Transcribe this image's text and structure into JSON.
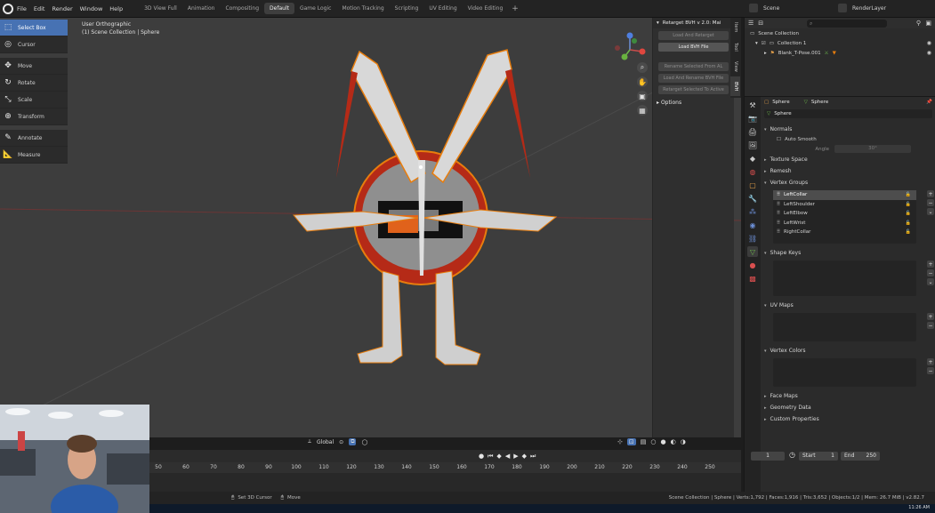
{
  "menu": [
    "File",
    "Edit",
    "Render",
    "Window",
    "Help"
  ],
  "workspaces": [
    "3D View Full",
    "Animation",
    "Compositing",
    "Default",
    "Game Logic",
    "Motion Tracking",
    "Scripting",
    "UV Editing",
    "Video Editing"
  ],
  "active_workspace": "Default",
  "scene": "Scene",
  "view_layer": "RenderLayer",
  "viewport": {
    "view_name": "User Orthographic",
    "collection_path": "(1) Scene Collection | Sphere"
  },
  "tools": [
    {
      "label": "Select Box",
      "icon": "select-box-icon"
    },
    {
      "label": "Cursor",
      "icon": "cursor-icon"
    },
    {
      "label": "Move",
      "icon": "move-icon"
    },
    {
      "label": "Rotate",
      "icon": "rotate-icon"
    },
    {
      "label": "Scale",
      "icon": "scale-icon"
    },
    {
      "label": "Transform",
      "icon": "transform-icon"
    },
    {
      "label": "Annotate",
      "icon": "annotate-icon"
    },
    {
      "label": "Measure",
      "icon": "measure-icon"
    }
  ],
  "npanel": {
    "title": "Retarget BVH v 2.0: Mai",
    "buttons": [
      {
        "label": "Load And Retarget",
        "enabled": false
      },
      {
        "label": "Load BVH File",
        "enabled": true
      },
      {
        "label": "Rename Selected From AL",
        "enabled": false
      },
      {
        "label": "Load And Rename BVH File",
        "enabled": false
      },
      {
        "label": "Retarget Selected To Active",
        "enabled": false
      }
    ],
    "options_label": "Options",
    "tabs": [
      "Item",
      "Tool",
      "View",
      "BVH"
    ]
  },
  "outliner": {
    "search_placeholder": "",
    "rows": [
      {
        "label": "Scene Collection",
        "indent": 0
      },
      {
        "label": "Collection 1",
        "indent": 1
      },
      {
        "label": "Blank_T-Pose.001",
        "indent": 2
      }
    ]
  },
  "properties": {
    "object_name": "Sphere",
    "mesh_name": "Sphere",
    "data_name": "Sphere",
    "sections": {
      "normals": "Normals",
      "auto_smooth": "Auto Smooth",
      "angle_label": "Angle",
      "angle_value": "30°",
      "texture_space": "Texture Space",
      "remesh": "Remesh",
      "vertex_groups": "Vertex Groups",
      "shape_keys": "Shape Keys",
      "uv_maps": "UV Maps",
      "vertex_colors": "Vertex Colors",
      "face_maps": "Face Maps",
      "geometry_data": "Geometry Data",
      "custom_properties": "Custom Properties"
    },
    "vertex_groups": [
      "LeftCollar",
      "LeftShoulder",
      "LeftElbow",
      "LeftWrist",
      "RightCollar"
    ],
    "selected_vertex_group": "LeftCollar"
  },
  "viewport_header2": {
    "transform_orientation": "Global"
  },
  "timeline": {
    "ticks": [
      "50",
      "60",
      "70",
      "80",
      "90",
      "100",
      "110",
      "120",
      "130",
      "140",
      "150",
      "160",
      "170",
      "180",
      "190",
      "200",
      "210",
      "220",
      "230",
      "240",
      "250"
    ],
    "current_frame": "1",
    "start_label": "Start",
    "start_value": "1",
    "end_label": "End",
    "end_value": "250"
  },
  "status": {
    "left1": "Set 3D Cursor",
    "left2": "Move",
    "right": "Scene Collection | Sphere | Verts:1,792 | Faces:1,916 | Tris:3,652 | Objects:1/2 | Mem: 26.7 MiB | v2.82.7"
  },
  "taskbar": {
    "clock": "11:26 AM"
  },
  "colors": {
    "accent": "#4772b3",
    "selection_orange": "#e87d0d",
    "viewport_bg": "#3d3d3d",
    "armature_red": "#b52a17"
  }
}
